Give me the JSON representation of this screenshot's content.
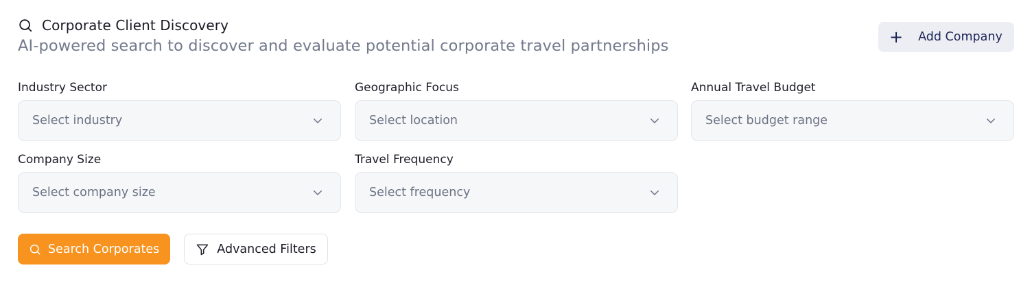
{
  "header": {
    "title": "Corporate Client Discovery",
    "subtitle": "AI-powered search to discover and evaluate potential corporate travel partnerships",
    "title_icon": "search-icon"
  },
  "add_button": {
    "icon": "plus-icon",
    "label": "Add Company"
  },
  "filters": [
    {
      "label": "Industry Sector",
      "placeholder": "Select industry"
    },
    {
      "label": "Geographic Focus",
      "placeholder": "Select location"
    },
    {
      "label": "Annual Travel Budget",
      "placeholder": "Select budget range"
    },
    {
      "label": "Company Size",
      "placeholder": "Select company size"
    },
    {
      "label": "Travel Frequency",
      "placeholder": "Select frequency"
    }
  ],
  "actions": {
    "search_label": "Search Corporates",
    "search_icon": "search-icon",
    "filters_label": "Advanced Filters",
    "filters_icon": "filter-icon"
  },
  "colors": {
    "accent": "#f7931e",
    "subtitle": "#737a8c",
    "secondary_button_bg": "#eceef3",
    "secondary_button_text": "#1b2456",
    "select_bg": "#f6f7f9"
  }
}
